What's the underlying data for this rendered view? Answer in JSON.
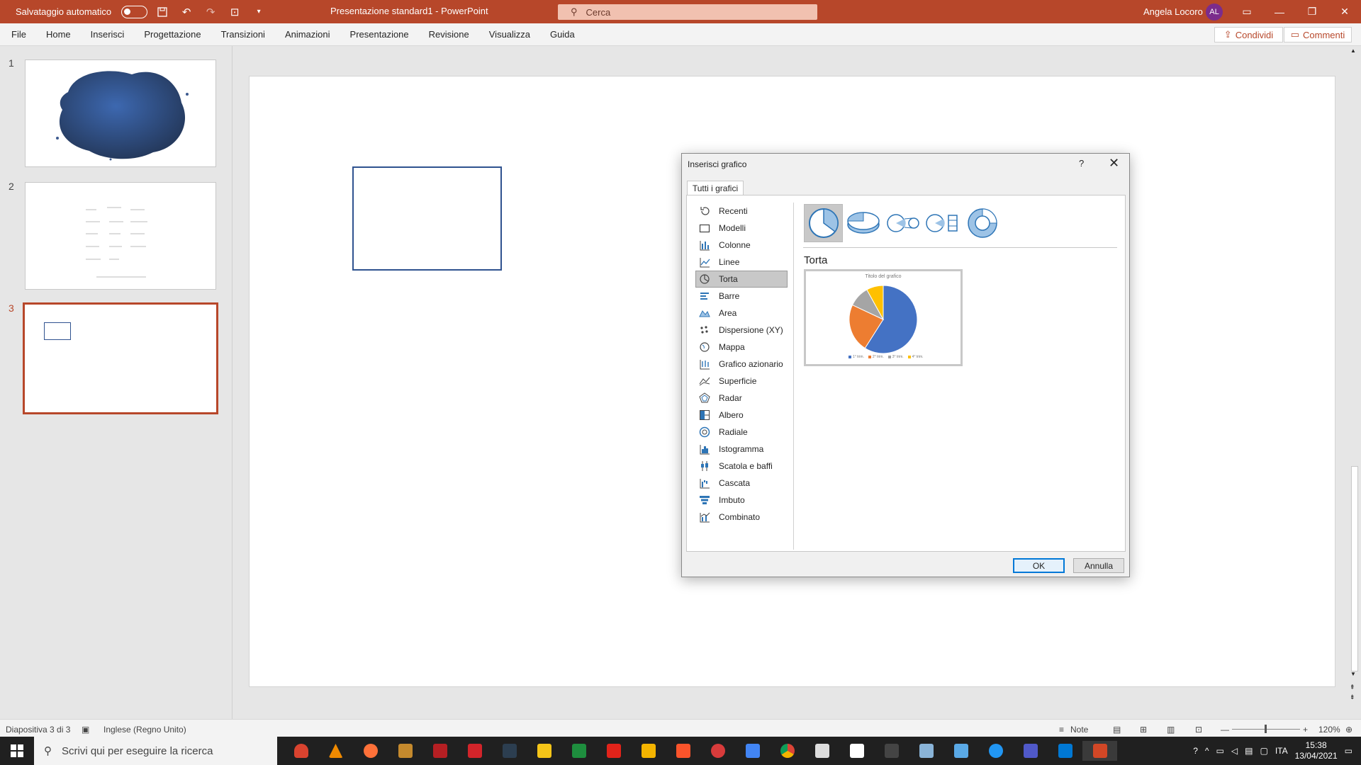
{
  "titlebar": {
    "autosave_label": "Salvataggio automatico",
    "doc_title": "Presentazione standard1  -  PowerPoint",
    "search_placeholder": "Cerca",
    "user_name": "Angela Locoro",
    "user_initials": "AL",
    "accent_color": "#b7472a"
  },
  "menu": {
    "items": [
      "File",
      "Home",
      "Inserisci",
      "Progettazione",
      "Transizioni",
      "Animazioni",
      "Presentazione",
      "Revisione",
      "Visualizza",
      "Guida"
    ],
    "share_label": "Condividi",
    "comments_label": "Commenti"
  },
  "thumbnails": {
    "numbers": [
      "1",
      "2",
      "3"
    ],
    "selected": "3"
  },
  "statusbar": {
    "slide_info": "Diapositiva 3 di 3",
    "language": "Inglese (Regno Unito)",
    "notes_label": "Note",
    "zoom": "120%"
  },
  "taskbar": {
    "search_placeholder": "Scrivi qui per eseguire la ricerca",
    "language": "ITA",
    "time": "15:38",
    "date": "13/04/2021"
  },
  "dialog": {
    "title": "Inserisci grafico",
    "help": "?",
    "tab_label": "Tutti i grafici",
    "categories": [
      "Recenti",
      "Modelli",
      "Colonne",
      "Linee",
      "Torta",
      "Barre",
      "Area",
      "Dispersione (XY)",
      "Mappa",
      "Grafico azionario",
      "Superficie",
      "Radar",
      "Albero",
      "Radiale",
      "Istogramma",
      "Scatola e baffi",
      "Cascata",
      "Imbuto",
      "Combinato"
    ],
    "selected_category": "Torta",
    "chart_name": "Torta",
    "preview_title": "Titolo del grafico",
    "preview_legend": [
      "1° trim.",
      "2° trim.",
      "3° trim.",
      "4° trim."
    ],
    "ok_label": "OK",
    "cancel_label": "Annulla"
  },
  "chart_data": {
    "type": "pie",
    "title": "Titolo del grafico",
    "categories": [
      "1° trim.",
      "2° trim.",
      "3° trim.",
      "4° trim."
    ],
    "values": [
      59,
      23,
      10,
      8
    ],
    "colors": [
      "#4472c4",
      "#ed7d31",
      "#a5a5a5",
      "#ffc000"
    ]
  }
}
